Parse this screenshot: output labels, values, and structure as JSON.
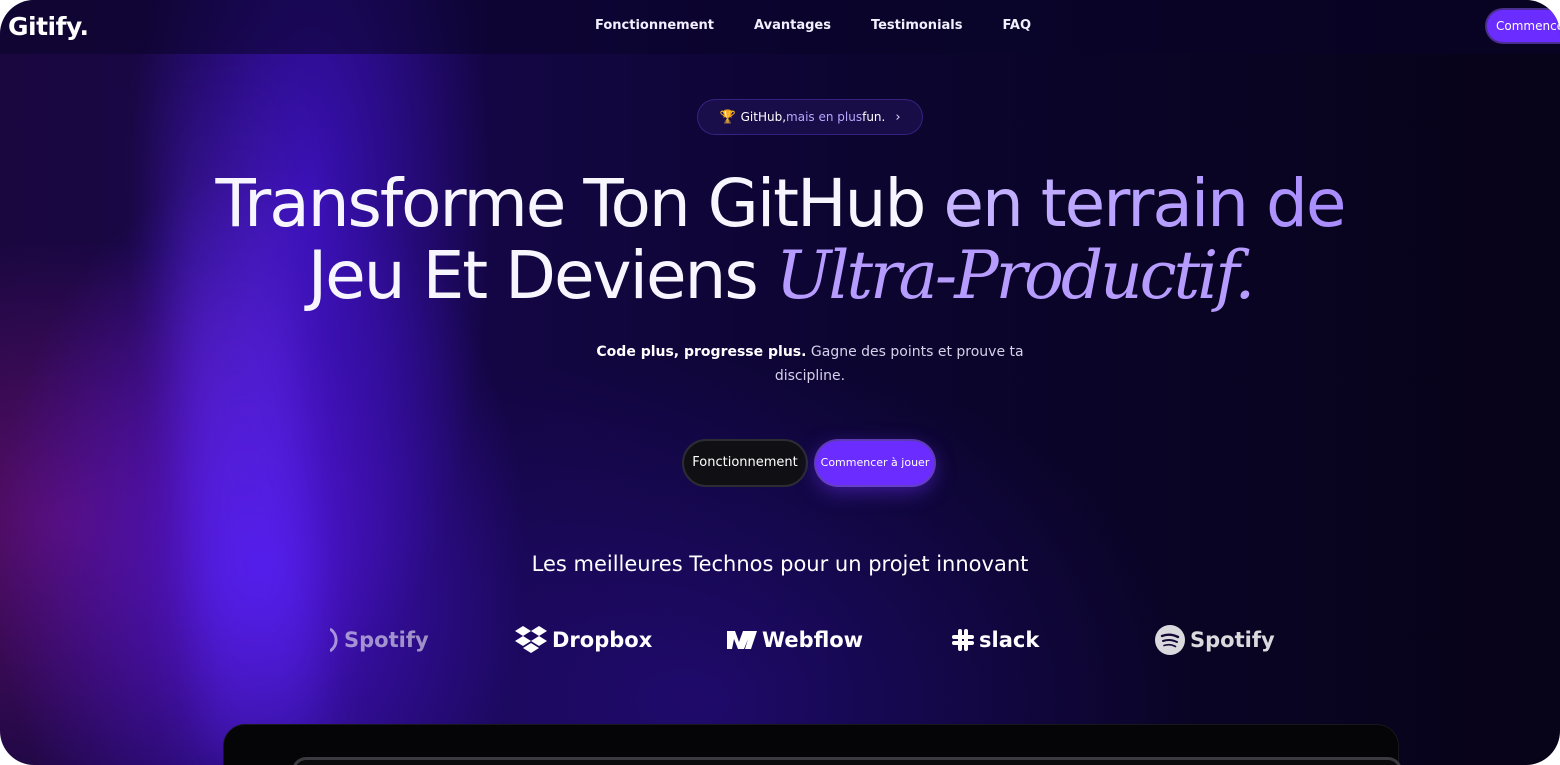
{
  "app": {
    "logo": "Gitify."
  },
  "nav": {
    "links": [
      "Fonctionnement",
      "Avantages",
      "Testimonials",
      "FAQ"
    ],
    "cta": "Commencer"
  },
  "hero": {
    "badge": {
      "part1": "GitHub,",
      "part2": " mais en plus",
      "part3": " fun.",
      "icon": "trophy-icon"
    },
    "headline": {
      "line1_a": "Transforme Ton GitHub",
      "line1_b": " en terrain de",
      "line2_a": "Jeu Et Deviens ",
      "line2_b": "Ultra-Productif."
    },
    "subtitle_bold": "Code plus, progresse plus.",
    "subtitle_rest": " Gagne des points et prouve ta discipline.",
    "buttons": {
      "secondary": "Fonctionnement",
      "primary": "Commencer à jouer"
    }
  },
  "techs": {
    "title": "Les meilleures Technos pour un projet innovant",
    "logos": [
      {
        "name": "Spotify",
        "icon": "spotify-icon"
      },
      {
        "name": "Dropbox",
        "icon": "dropbox-icon"
      },
      {
        "name": "Webflow",
        "icon": "webflow-icon"
      },
      {
        "name": "slack",
        "icon": "slack-icon"
      },
      {
        "name": "Spotify",
        "icon": "spotify-icon"
      }
    ]
  },
  "colors": {
    "accent": "#6a2cff",
    "background": "#0c0530",
    "highlight": "#b79cff"
  }
}
